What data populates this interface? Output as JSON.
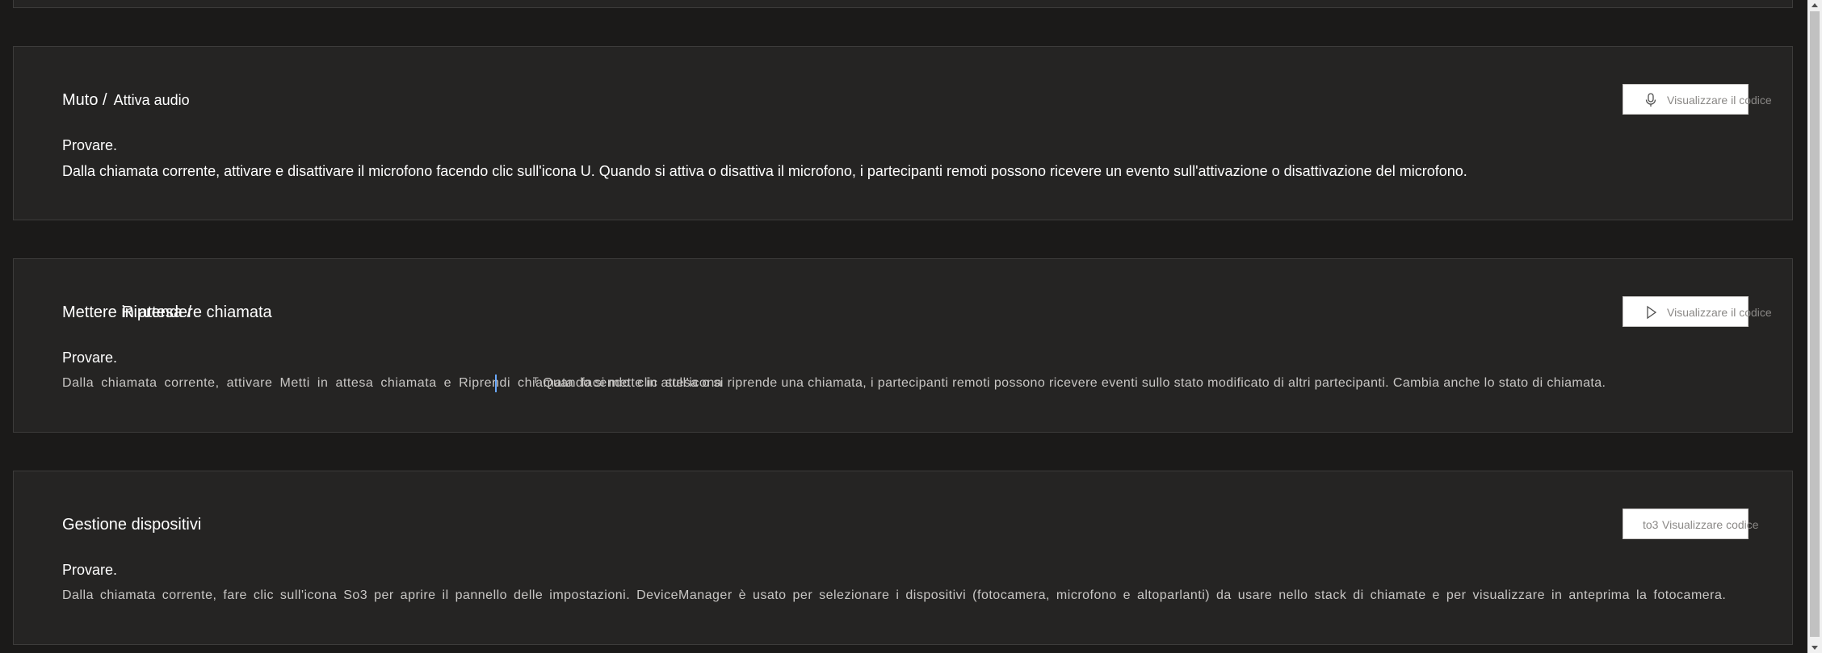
{
  "sections": [
    {
      "title_part1": "Muto /",
      "title_part2": "Attiva audio",
      "try_label": "Provare.",
      "description": "Dalla chiamata corrente, attivare e disattivare il microfono facendo clic sull'icona U. Quando si attiva o disattiva il microfono, i partecipanti remoti possono ricevere un evento sull'attivazione o disattivazione del microfono.",
      "button_label": "Visualizzare il codice",
      "button_icon": "microphone-icon"
    },
    {
      "title_part1": "Mettere in attesa /",
      "title_part2": "Riprendere chiamata",
      "try_label": "Provare.",
      "description": "Dalla chiamata corrente, attivare Metti in attesa chiamata e Riprendi chiamata facendo clic sull'icona",
      "description_overlay": "ᵀ Quando si mette in attesa o si riprende una chiamata, i partecipanti remoti possono ricevere eventi sullo stato modificato di altri partecipanti. Cambia anche lo stato di chiamata.",
      "button_label": "Visualizzare il codice",
      "button_icon": "play-icon"
    },
    {
      "title_part1": "Gestione dispositivi",
      "try_label": "Provare.",
      "description": "Dalla chiamata corrente, fare clic sull'icona So3 per aprire il pannello delle impostazioni. DeviceManager è usato per selezionare i dispositivi (fotocamera, microfono e altoparlanti) da usare nello stack di chiamate e per visualizzare in anteprima la fotocamera.",
      "button_prefix": "to3",
      "button_label": "Visualizzare codice"
    }
  ],
  "colors": {
    "background": "#1b1a19",
    "card": "#252423",
    "card_border": "#3d3c3b",
    "text_primary": "#ffffff",
    "text_muted": "#c8c6c4",
    "button_bg": "#ffffff",
    "button_text": "#8a8886"
  }
}
